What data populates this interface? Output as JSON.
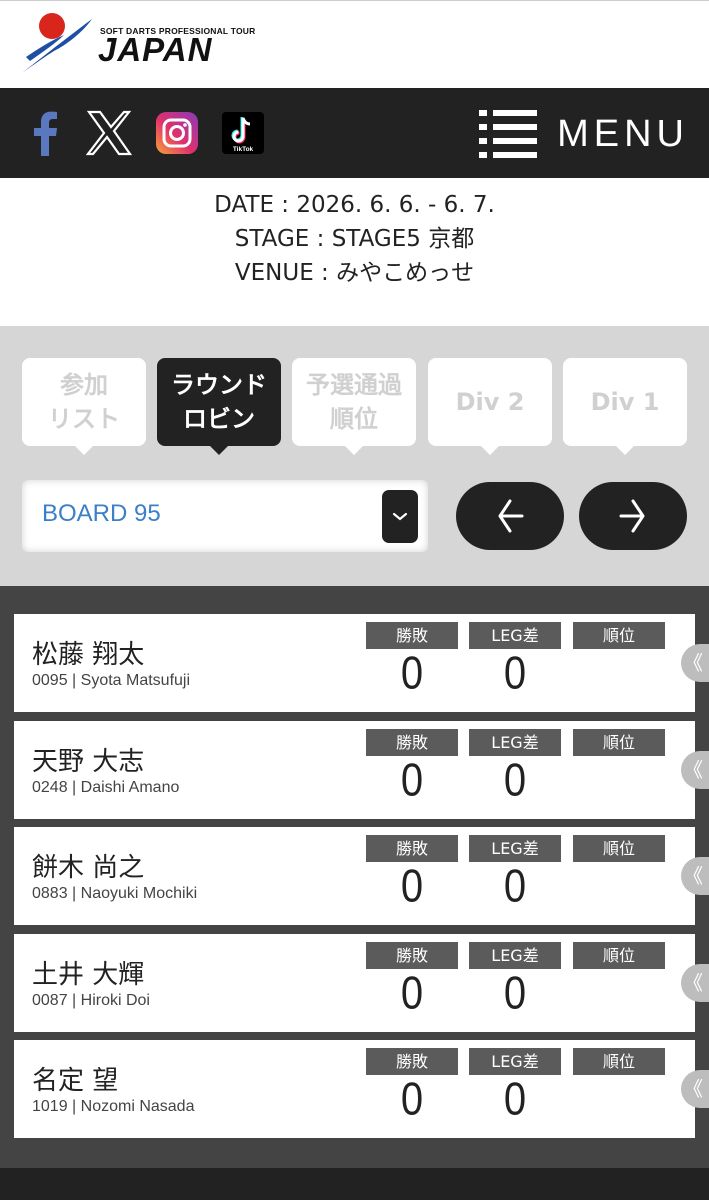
{
  "brand": {
    "small_text": "SOFT DARTS PROFESSIONAL TOUR",
    "big_text": "JAPAN"
  },
  "nav": {
    "social": [
      {
        "icon": "facebook-icon"
      },
      {
        "icon": "x-icon"
      },
      {
        "icon": "instagram-icon"
      },
      {
        "icon": "tiktok-icon",
        "label": "TikTok"
      }
    ],
    "menu_label": "MENU"
  },
  "event": {
    "date": "DATE : 2026. 6. 6. - 6. 7.",
    "stage": "STAGE : STAGE5 京都",
    "venue": "VENUE : みやこめっせ"
  },
  "tabs": [
    {
      "line1": "参加",
      "line2": "リスト",
      "active": false
    },
    {
      "line1": "ラウンド",
      "line2": "ロビン",
      "active": true
    },
    {
      "line1": "予選通過",
      "line2": "順位",
      "active": false
    },
    {
      "line1": "Div 2",
      "line2": "",
      "active": false
    },
    {
      "line1": "Div 1",
      "line2": "",
      "active": false
    }
  ],
  "board": {
    "selected": "BOARD 95"
  },
  "stat_headers": {
    "record": "勝敗",
    "leg_diff": "LEG差",
    "rank": "順位"
  },
  "players": [
    {
      "name": "松藤 翔太",
      "sub": "0095 | Syota Matsufuji",
      "record": "0",
      "leg_diff": "0",
      "rank": ""
    },
    {
      "name": "天野 大志",
      "sub": "0248 | Daishi Amano",
      "record": "0",
      "leg_diff": "0",
      "rank": ""
    },
    {
      "name": "餅木 尚之",
      "sub": "0883 | Naoyuki Mochiki",
      "record": "0",
      "leg_diff": "0",
      "rank": ""
    },
    {
      "name": "土井 大輝",
      "sub": "0087 | Hiroki Doi",
      "record": "0",
      "leg_diff": "0",
      "rank": ""
    },
    {
      "name": "名定 望",
      "sub": "1019 | Nozomi Nasada",
      "record": "0",
      "leg_diff": "0",
      "rank": ""
    }
  ],
  "colors": {
    "dark": "#222222",
    "board_text": "#3a7fc8",
    "stat_header": "#5b5b5b",
    "list_bg": "#444444",
    "controls_bg": "#d6d6d6"
  }
}
